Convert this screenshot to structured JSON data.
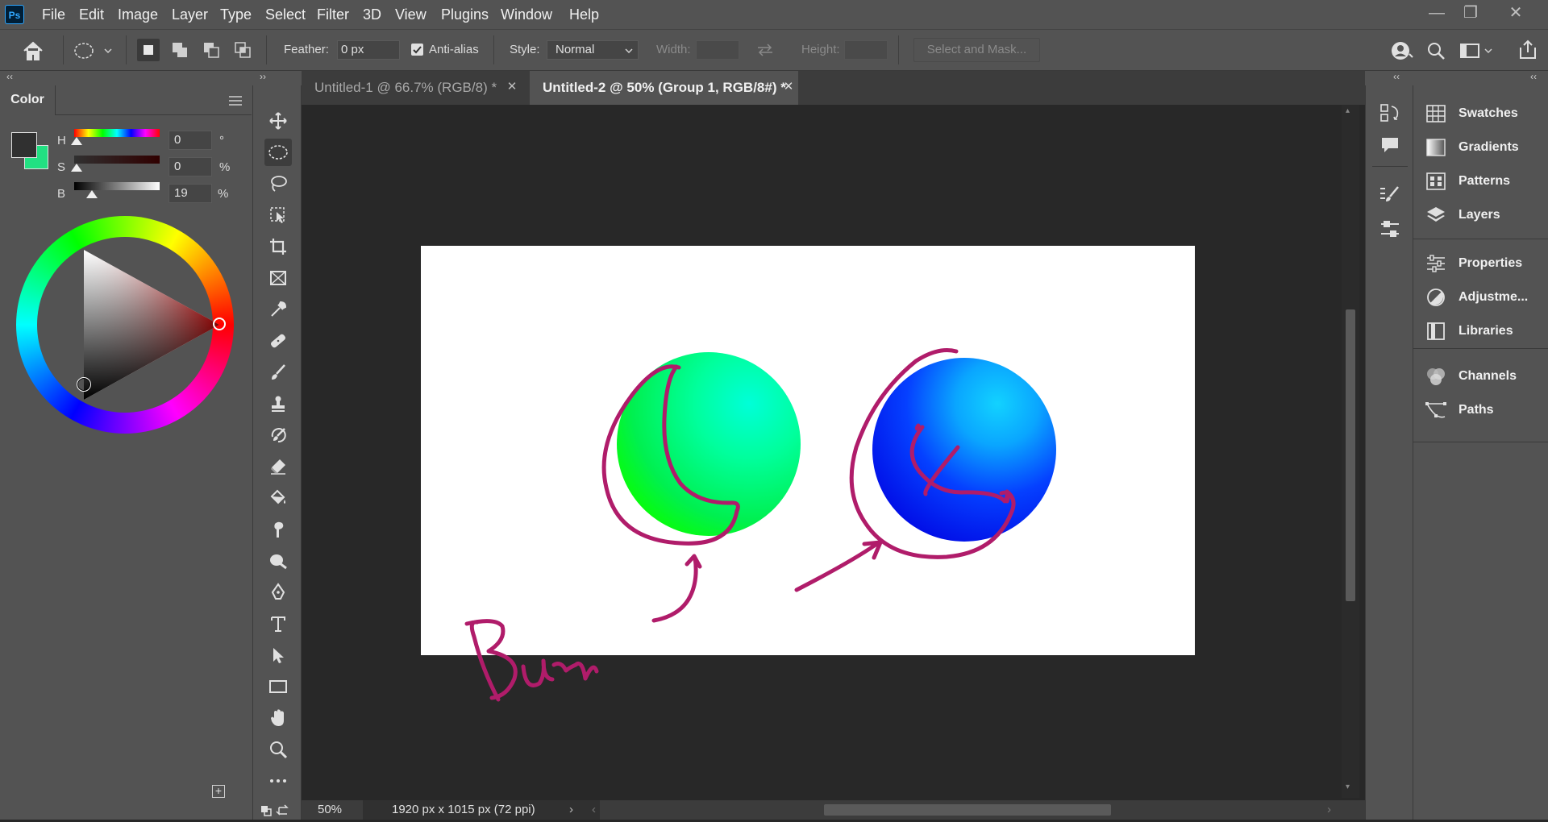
{
  "app": {
    "logo": "Ps"
  },
  "menu": [
    "File",
    "Edit",
    "Image",
    "Layer",
    "Type",
    "Select",
    "Filter",
    "3D",
    "View",
    "Plugins",
    "Window",
    "Help"
  ],
  "window_controls": {
    "minimize": "—",
    "restore": "❐",
    "close": "✕"
  },
  "options_bar": {
    "feather_label": "Feather:",
    "feather_value": "0 px",
    "anti_alias_label": "Anti-alias",
    "anti_alias_checked": true,
    "style_label": "Style:",
    "style_value": "Normal",
    "width_label": "Width:",
    "height_label": "Height:",
    "select_mask_label": "Select and Mask..."
  },
  "tabs": [
    {
      "label": "Untitled-1 @ 66.7% (RGB/8) *",
      "active": false
    },
    {
      "label": "Untitled-2 @ 50% (Group 1, RGB/8#) *",
      "active": true
    }
  ],
  "color_panel": {
    "title": "Color",
    "h_label": "H",
    "h_value": "0",
    "h_unit": "°",
    "s_label": "S",
    "s_value": "0",
    "s_unit": "%",
    "b_label": "B",
    "b_value": "19",
    "b_unit": "%",
    "foreground": "#303030",
    "background": "#22e082"
  },
  "status": {
    "zoom": "50%",
    "doc_info": "1920 px x 1015 px (72 ppi)"
  },
  "right_panels": {
    "group1": [
      "Swatches",
      "Gradients",
      "Patterns",
      "Layers"
    ],
    "group2": [
      "Properties",
      "Adjustme...",
      "Libraries"
    ],
    "group3": [
      "Channels",
      "Paths"
    ]
  },
  "canvas": {
    "handwriting": "Burn",
    "annotation_color": "#b01c6a"
  }
}
